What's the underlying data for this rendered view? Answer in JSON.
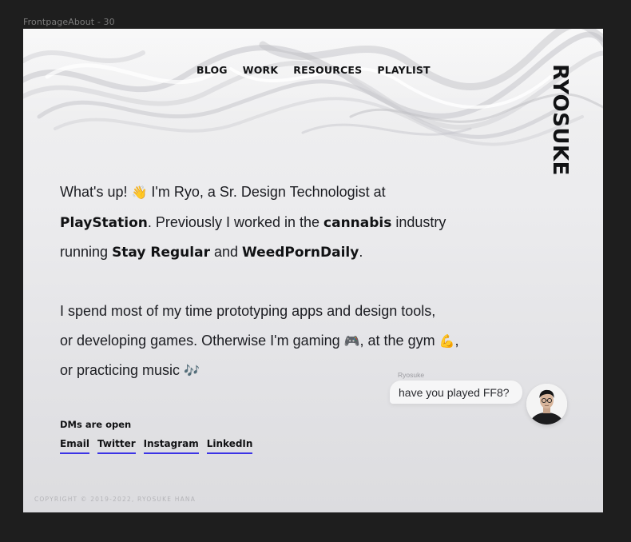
{
  "frame": {
    "label": "FrontpageAbout - 30"
  },
  "nav": {
    "items": [
      {
        "label": "BLOG"
      },
      {
        "label": "WORK"
      },
      {
        "label": "RESOURCES"
      },
      {
        "label": "PLAYLIST"
      }
    ]
  },
  "logo": {
    "text": "RYOSUKE"
  },
  "intro": {
    "line1_pre": "What's up! ",
    "wave_emoji": "👋",
    "line1_post": " I'm Ryo, a Sr. Design Technologist at",
    "brand_playstation": "PlayStation",
    "line2_mid": ". Previously I worked in the ",
    "brand_cannabis": "cannabis",
    "line2_post": " industry",
    "line3_pre": "running ",
    "brand_stay_regular": "Stay Regular",
    "line3_mid": " and ",
    "brand_weedporndaily": "WeedPornDaily",
    "line3_post": ".",
    "line4": "I spend most of my time prototyping apps and design tools,",
    "line5_pre": "or developing games. Otherwise I'm gaming ",
    "gamepad_emoji": "🎮",
    "line5_mid": ", at the gym ",
    "muscle_emoji": "💪",
    "line5_post": ",",
    "line6_pre": "or practicing music ",
    "music_emoji": "🎶"
  },
  "contact": {
    "title": "DMs are open",
    "links": [
      {
        "label": "Email"
      },
      {
        "label": "Twitter"
      },
      {
        "label": "Instagram"
      },
      {
        "label": "LinkedIn"
      }
    ],
    "underline_color": "#3b33e6"
  },
  "chat": {
    "sender": "Ryosuke",
    "message": "have you played FF8?"
  },
  "footer": {
    "copyright": "COPYRIGHT © 2019-2022, RYOSUKE HANA"
  }
}
